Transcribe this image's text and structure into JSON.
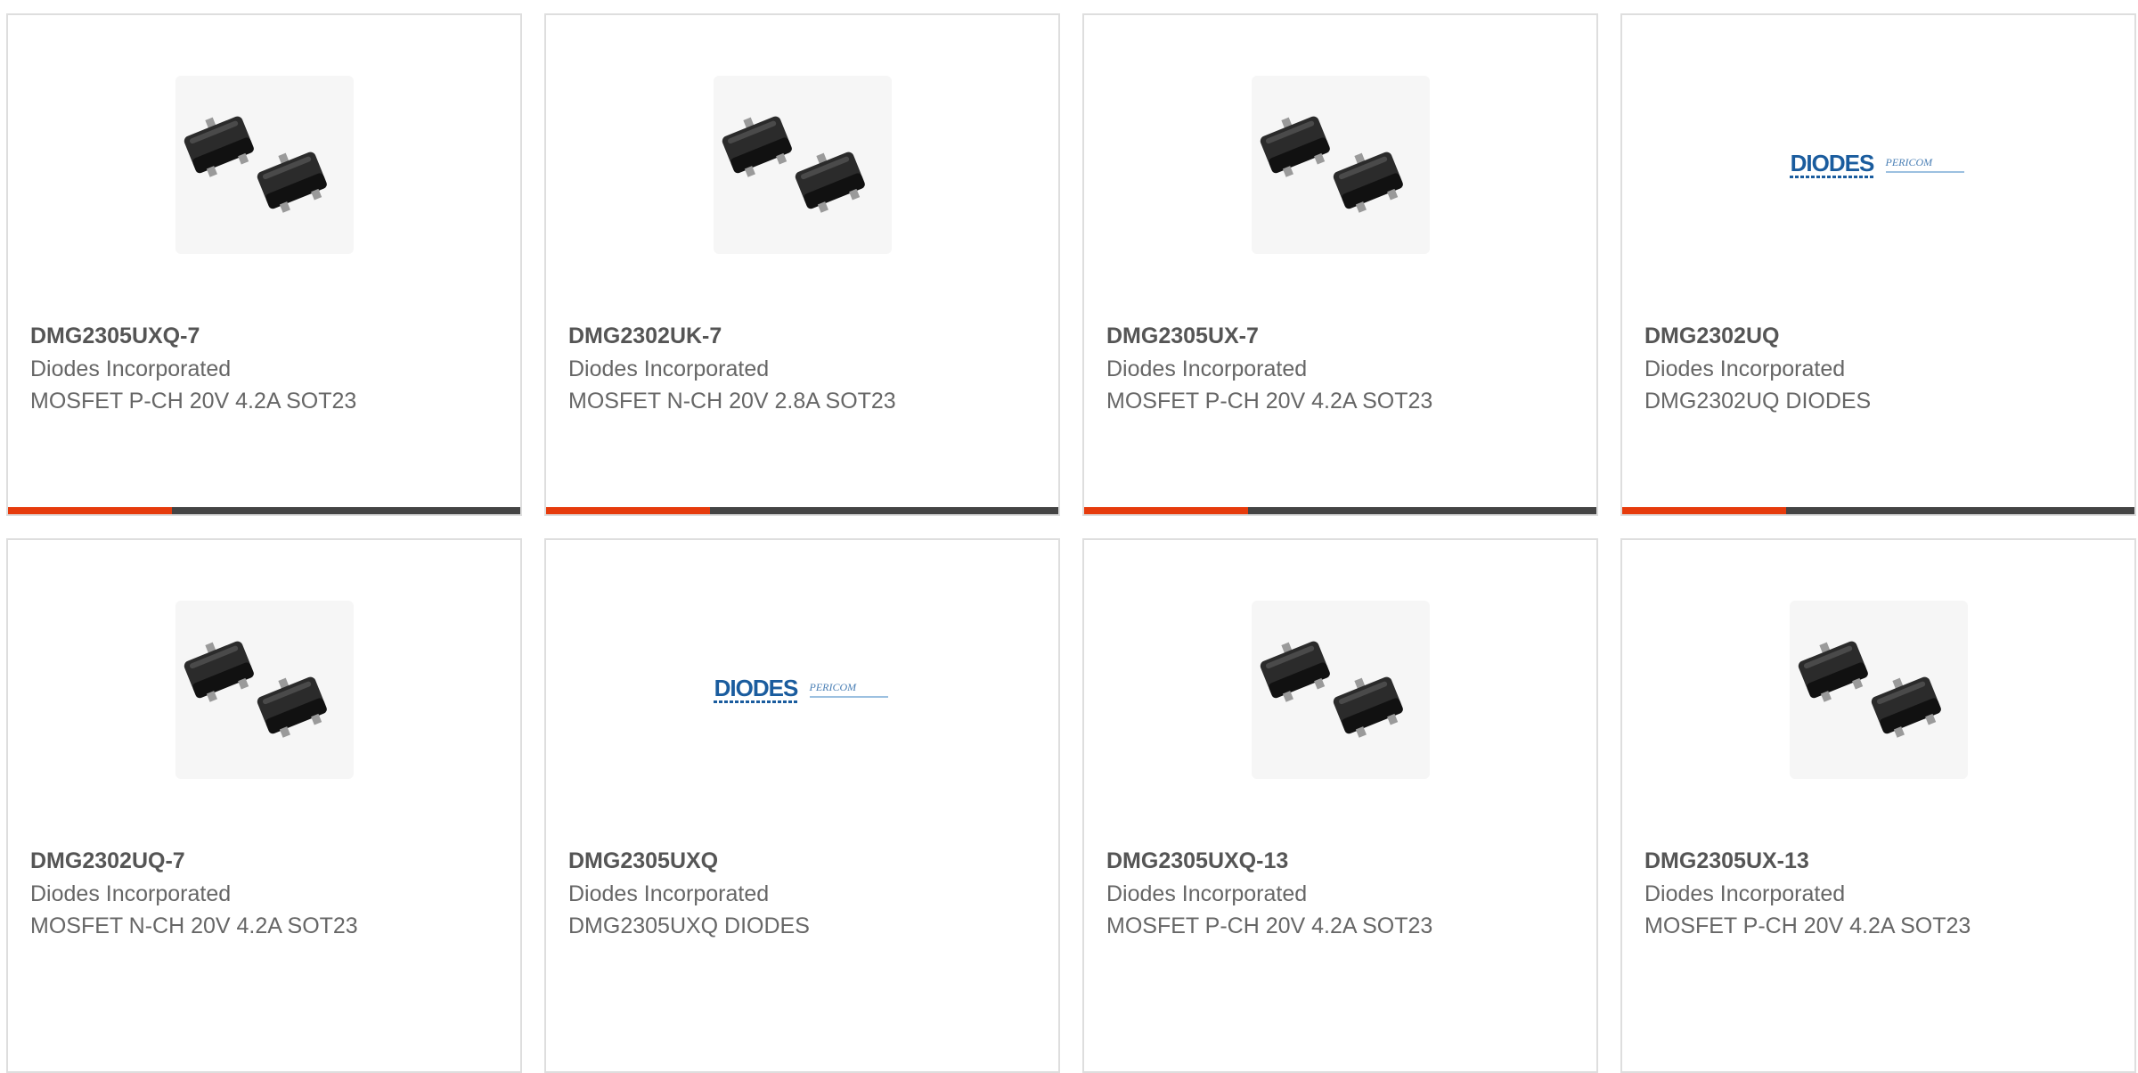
{
  "colors": {
    "accent": "#e63b0c",
    "track": "#444444",
    "card_border": "#dedede",
    "text_primary": "#555555",
    "text_secondary": "#666666",
    "brand_blue": "#1a5c9e"
  },
  "products": [
    {
      "part_number": "DMG2305UXQ-7",
      "manufacturer": "Diodes Incorporated",
      "description": "MOSFET P-CH 20V 4.2A SOT23",
      "image": "sot23-package-photo",
      "progress": 0.32
    },
    {
      "part_number": "DMG2302UK-7",
      "manufacturer": "Diodes Incorporated",
      "description": "MOSFET N-CH 20V 2.8A SOT23",
      "image": "sot23-package-photo",
      "progress": 0.32
    },
    {
      "part_number": "DMG2305UX-7",
      "manufacturer": "Diodes Incorporated",
      "description": "MOSFET P-CH 20V 4.2A SOT23",
      "image": "sot23-package-photo",
      "progress": 0.32
    },
    {
      "part_number": "DMG2302UQ",
      "manufacturer": "Diodes Incorporated",
      "description": "DMG2302UQ DIODES",
      "image": "diodes-pericom-logo",
      "progress": 0.32
    },
    {
      "part_number": "DMG2302UQ-7",
      "manufacturer": "Diodes Incorporated",
      "description": "MOSFET N-CH 20V 4.2A SOT23",
      "image": "sot23-package-photo"
    },
    {
      "part_number": "DMG2305UXQ",
      "manufacturer": "Diodes Incorporated",
      "description": "DMG2305UXQ DIODES",
      "image": "diodes-pericom-logo"
    },
    {
      "part_number": "DMG2305UXQ-13",
      "manufacturer": "Diodes Incorporated",
      "description": "MOSFET P-CH 20V 4.2A SOT23",
      "image": "sot23-package-photo"
    },
    {
      "part_number": "DMG2305UX-13",
      "manufacturer": "Diodes Incorporated",
      "description": "MOSFET P-CH 20V 4.2A SOT23",
      "image": "sot23-package-photo"
    }
  ],
  "brand_logo": {
    "main": "DIODES",
    "sub": "PERICOM"
  }
}
